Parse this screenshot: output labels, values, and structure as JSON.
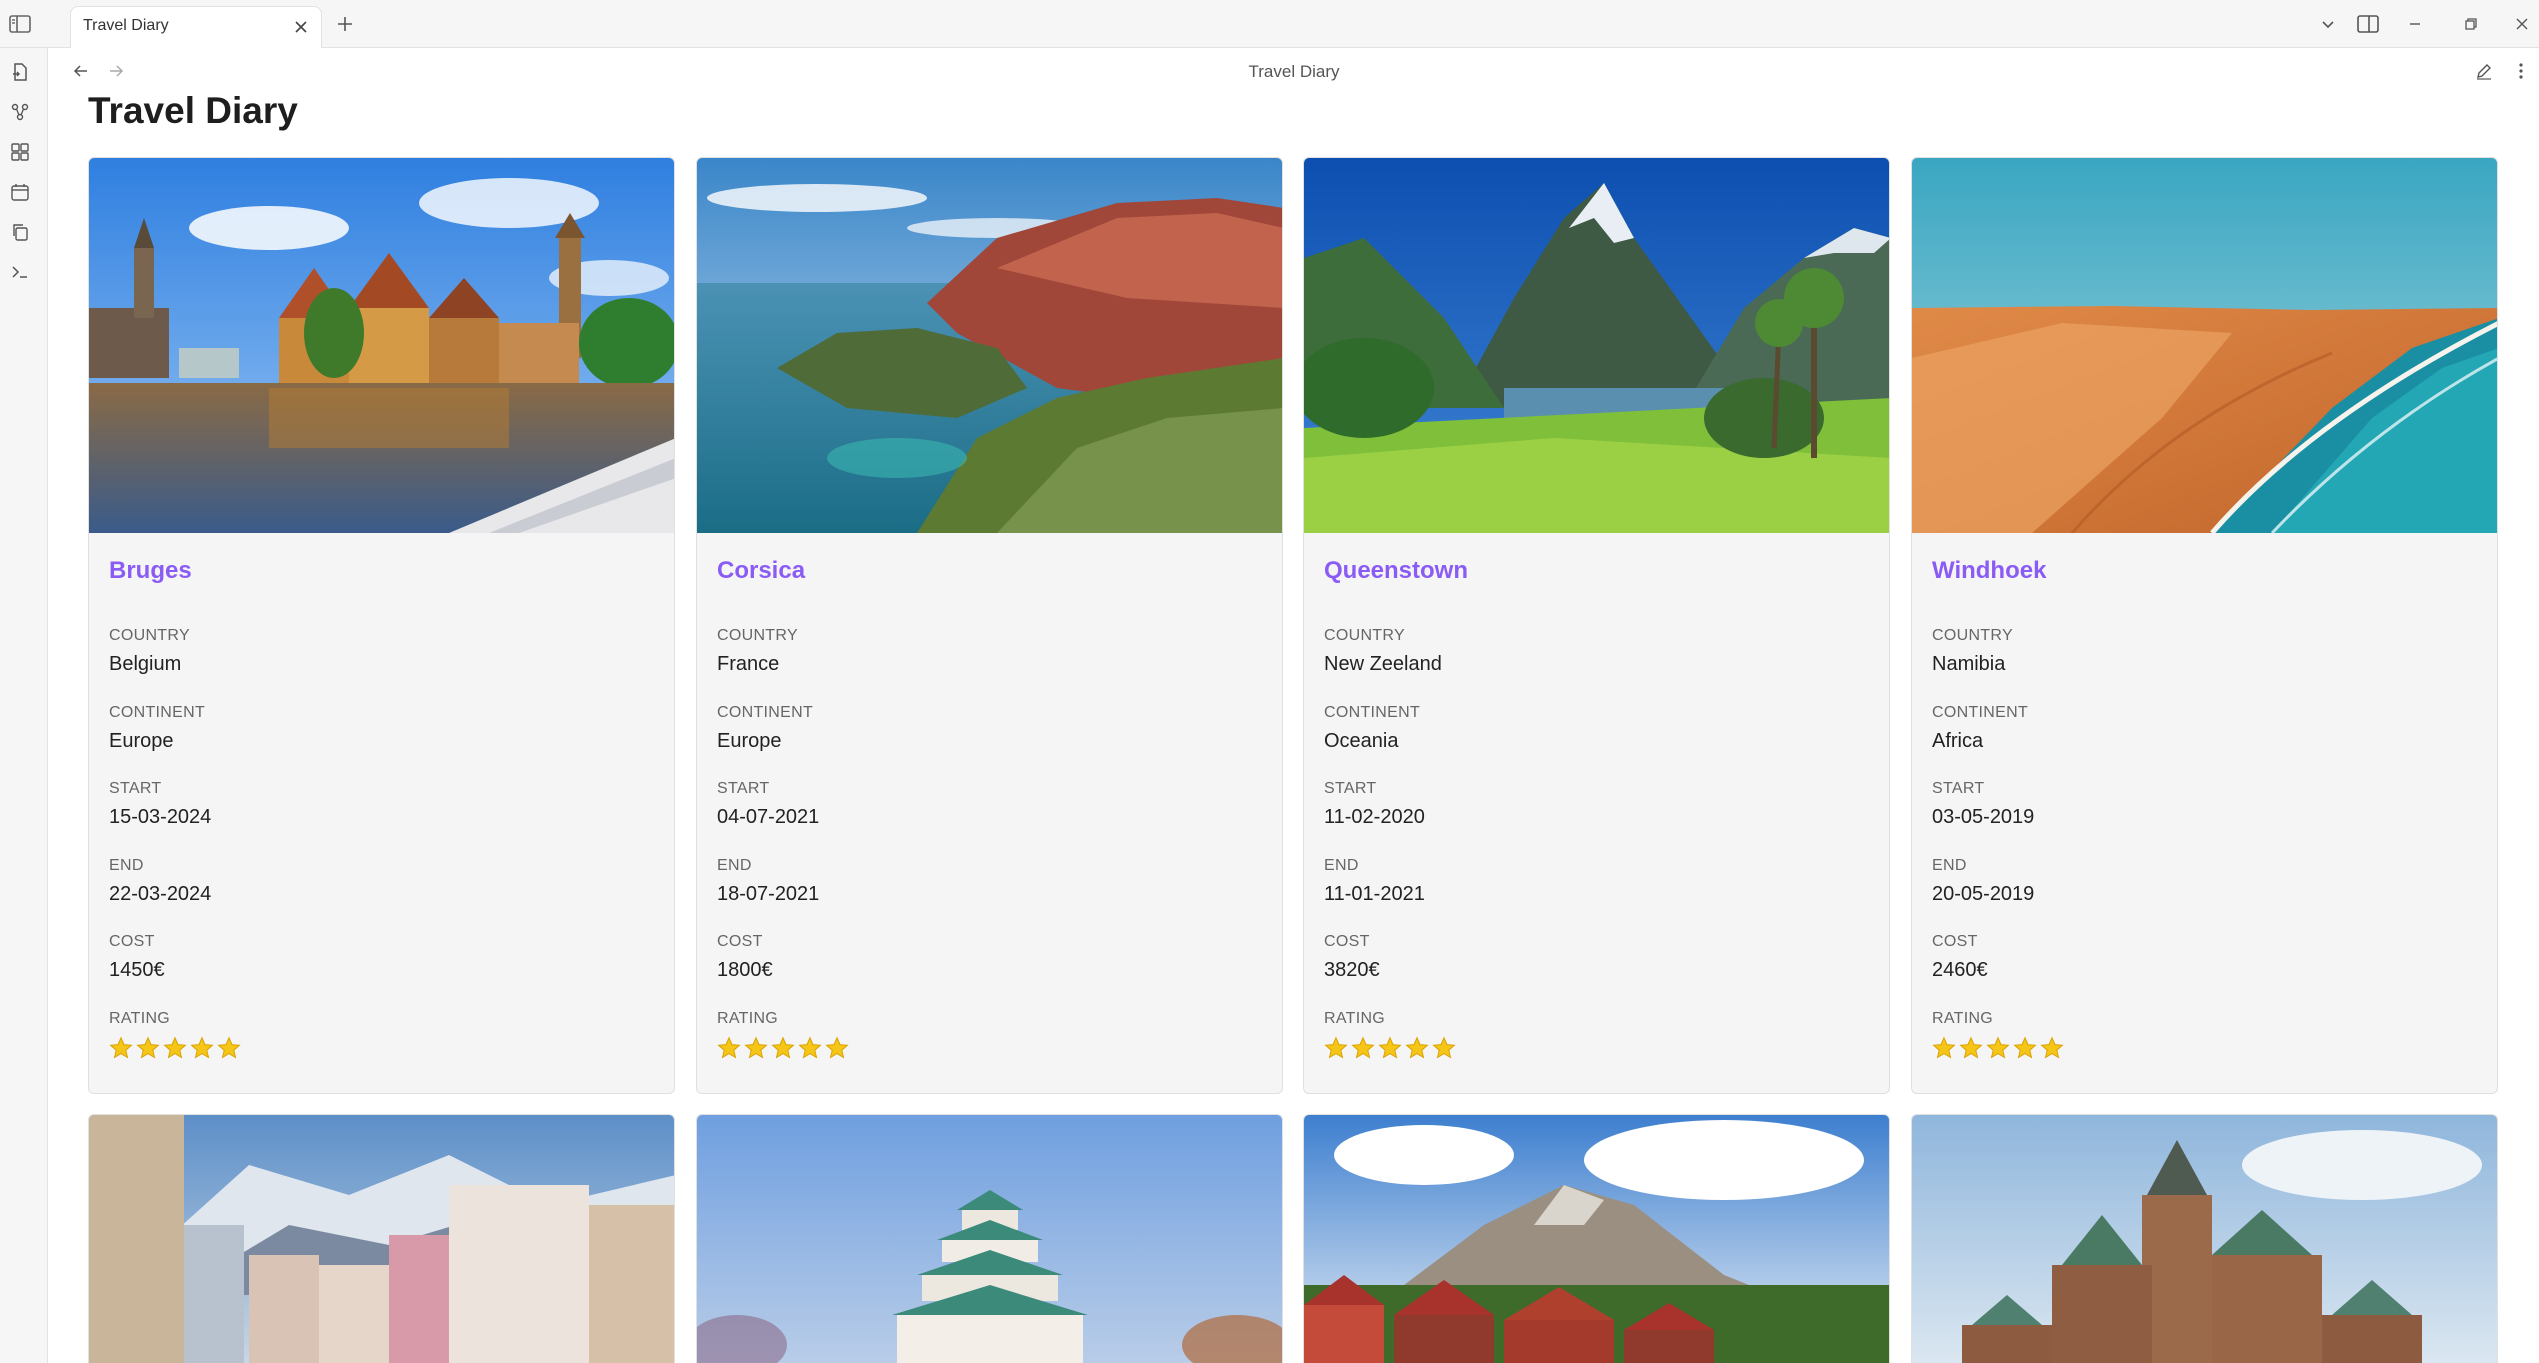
{
  "tabbar": {
    "tab_title": "Travel Diary"
  },
  "view": {
    "title": "Travel Diary"
  },
  "page": {
    "heading": "Travel Diary"
  },
  "labels": {
    "country": "COUNTRY",
    "continent": "CONTINENT",
    "start": "START",
    "end": "END",
    "cost": "COST",
    "rating": "RATING"
  },
  "colors": {
    "accent": "#8a5cf5",
    "star": "#f5c518"
  },
  "cards": [
    {
      "name": "Bruges",
      "country": "Belgium",
      "continent": "Europe",
      "start": "15-03-2024",
      "end": "22-03-2024",
      "cost": "1450€",
      "rating": 5
    },
    {
      "name": "Corsica",
      "country": "France",
      "continent": "Europe",
      "start": "04-07-2021",
      "end": "18-07-2021",
      "cost": "1800€",
      "rating": 5
    },
    {
      "name": "Queenstown",
      "country": "New Zeeland",
      "continent": "Oceania",
      "start": "11-02-2020",
      "end": "11-01-2021",
      "cost": "3820€",
      "rating": 5
    },
    {
      "name": "Windhoek",
      "country": "Namibia",
      "continent": "Africa",
      "start": "03-05-2019",
      "end": "20-05-2019",
      "cost": "2460€",
      "rating": 5
    }
  ],
  "icons": {
    "ribbon": [
      "open-file-icon",
      "graph-view-icon",
      "canvas-icon",
      "calendar-icon",
      "copy-icon",
      "terminal-icon"
    ]
  }
}
